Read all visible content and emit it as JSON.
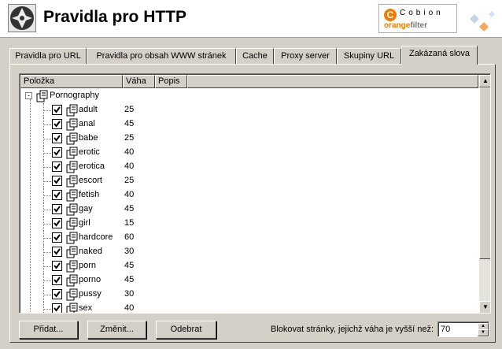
{
  "header": {
    "title": "Pravidla pro HTTP",
    "logo_top": "Cobion",
    "logo_orange": "orange",
    "logo_filter": "filter",
    "brand_color": "#f07c00"
  },
  "tabs": [
    {
      "label": "Pravidla pro URL",
      "active": false
    },
    {
      "label": "Pravidla pro obsah WWW stránek",
      "active": false
    },
    {
      "label": "Cache",
      "active": false
    },
    {
      "label": "Proxy server",
      "active": false
    },
    {
      "label": "Skupiny URL",
      "active": false
    },
    {
      "label": "Zakázaná slova",
      "active": true
    }
  ],
  "list": {
    "columns": [
      "Položka",
      "Váha",
      "Popis"
    ],
    "root": {
      "label": "Pornography",
      "expander": "-",
      "icon": "word-group-icon"
    },
    "items": [
      {
        "label": "adult",
        "weight": "25",
        "checked": true
      },
      {
        "label": "anal",
        "weight": "45",
        "checked": true
      },
      {
        "label": "babe",
        "weight": "25",
        "checked": true
      },
      {
        "label": "erotic",
        "weight": "40",
        "checked": true
      },
      {
        "label": "erotica",
        "weight": "40",
        "checked": true
      },
      {
        "label": "escort",
        "weight": "25",
        "checked": true
      },
      {
        "label": "fetish",
        "weight": "40",
        "checked": true
      },
      {
        "label": "gay",
        "weight": "45",
        "checked": true
      },
      {
        "label": "girl",
        "weight": "15",
        "checked": true
      },
      {
        "label": "hardcore",
        "weight": "60",
        "checked": true
      },
      {
        "label": "naked",
        "weight": "30",
        "checked": true
      },
      {
        "label": "porn",
        "weight": "45",
        "checked": true
      },
      {
        "label": "porno",
        "weight": "45",
        "checked": true
      },
      {
        "label": "pussy",
        "weight": "30",
        "checked": true
      },
      {
        "label": "sex",
        "weight": "40",
        "checked": true
      }
    ]
  },
  "buttons": {
    "add": "Přidat...",
    "edit": "Změnit...",
    "remove": "Odebrat"
  },
  "block": {
    "label": "Blokovat stránky, jejichž váha je vyšší než:",
    "value": "70"
  }
}
